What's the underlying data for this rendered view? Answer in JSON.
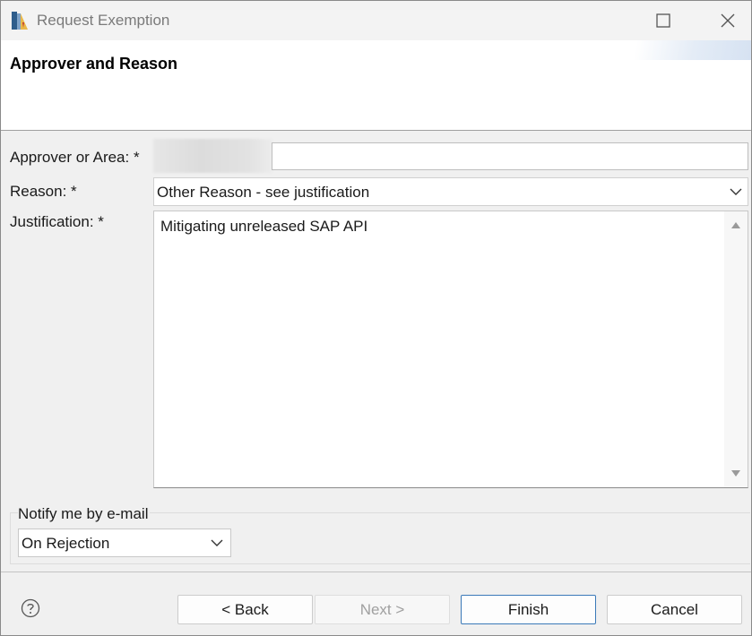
{
  "window": {
    "title": "Request Exemption"
  },
  "header": {
    "title": "Approver and Reason"
  },
  "form": {
    "approver_label": "Approver or Area: *",
    "approver_value": "",
    "reason_label": "Reason: *",
    "reason_value": "Other Reason - see justification",
    "justification_label": "Justification: *",
    "justification_value": "Mitigating unreleased SAP API"
  },
  "notify": {
    "legend": "Notify me by e-mail",
    "selected": "On Rejection"
  },
  "footer": {
    "back_label": "< Back",
    "next_label": "Next >",
    "finish_label": "Finish",
    "cancel_label": "Cancel"
  },
  "icons": {
    "app": "app-icon",
    "minimize": "minimize-icon",
    "maximize": "maximize-icon",
    "close": "close-icon",
    "dropdown": "chevron-down-icon",
    "help": "help-icon",
    "scroll_up": "scroll-up-icon",
    "scroll_down": "scroll-down-icon"
  },
  "colors": {
    "accent": "#3a79b8",
    "background": "#f0f0f0"
  }
}
